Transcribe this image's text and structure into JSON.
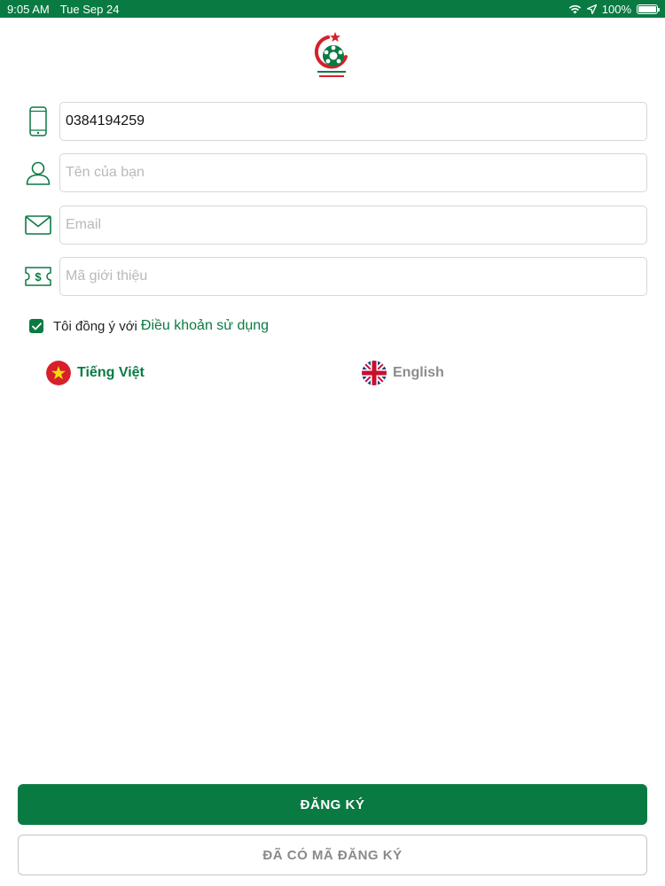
{
  "status_bar": {
    "time": "9:05 AM",
    "date": "Tue Sep 24",
    "battery": "100%",
    "battery_level": 1.0
  },
  "colors": {
    "brand": "#0a7a43",
    "placeholder": "#b9b9b9",
    "border": "#d7d7d7",
    "muted": "#8a8a8a"
  },
  "form": {
    "phone": {
      "value": "0384194259",
      "placeholder": "",
      "icon": "phone-icon"
    },
    "name": {
      "value": "",
      "placeholder": "Tên của bạn",
      "icon": "user-icon"
    },
    "email": {
      "value": "",
      "placeholder": "Email",
      "icon": "mail-icon"
    },
    "referral": {
      "value": "",
      "placeholder": "Mã giới thiệu",
      "icon": "money-ticket-icon"
    }
  },
  "terms": {
    "text": "Tôi đồng ý với",
    "link": "Điều khoản sử dụng",
    "checked": true
  },
  "languages": {
    "vi": {
      "label": "Tiếng Việt",
      "selected": true
    },
    "en": {
      "label": "English",
      "selected": false
    }
  },
  "buttons": {
    "register": "ĐĂNG KÝ",
    "have_code": "ĐÃ CÓ MÃ ĐĂNG KÝ"
  }
}
